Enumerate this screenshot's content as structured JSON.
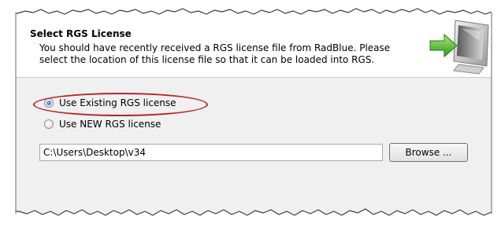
{
  "header": {
    "title": "Select RGS License",
    "description_line1": "You should have recently received a RGS license file from RadBlue. Please",
    "description_line2": "select the location of this license file so that it can be loaded into RGS."
  },
  "options": {
    "existing_label": "Use Existing RGS  license",
    "existing_selected": true,
    "new_label": "Use NEW RGS license",
    "new_selected": false
  },
  "license_path": {
    "value": "C:\\Users\\Desktop\\v34"
  },
  "browse_button": {
    "label": "Browse ..."
  },
  "colors": {
    "highlight": "#b3262c",
    "dialog_background": "#f0f0f0",
    "header_background": "#ffffff"
  },
  "icons": {
    "header": "computer-arrow-icon"
  }
}
